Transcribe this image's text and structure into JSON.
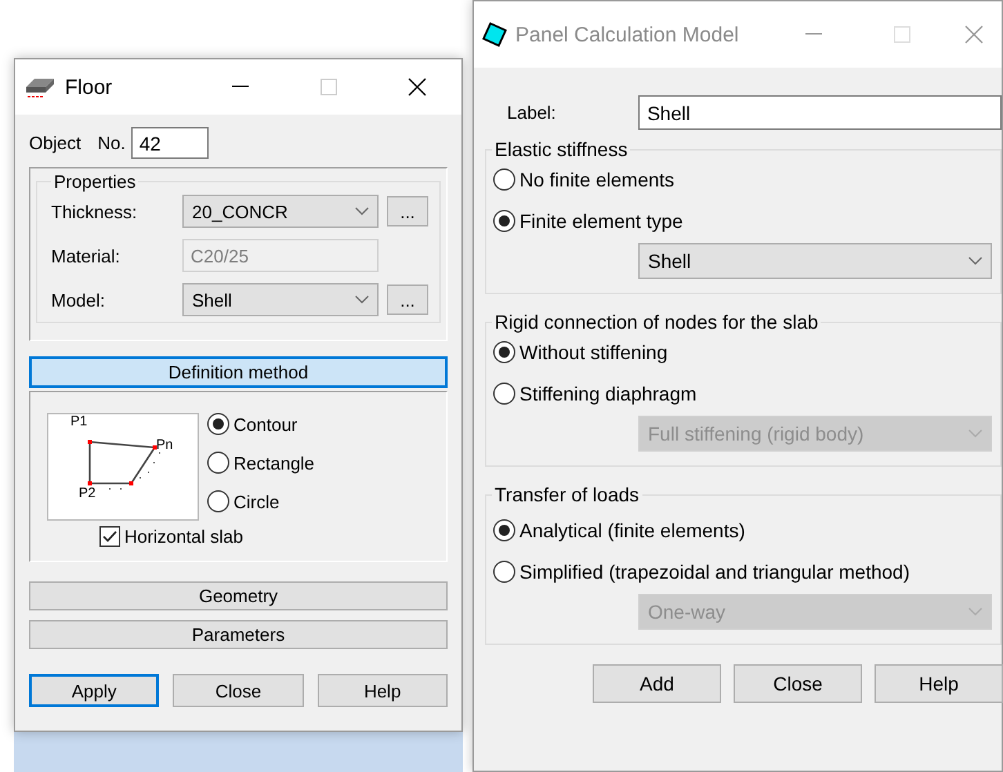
{
  "floor_window": {
    "title": "Floor",
    "active": true,
    "object_label": "Object",
    "number_label": "No.",
    "number_value": "42",
    "properties": {
      "title": "Properties",
      "rows": [
        {
          "kind": "dropdown",
          "label": "Thickness:",
          "value": "20_CONCR",
          "more": "..."
        },
        {
          "kind": "readonly",
          "label": "Material:",
          "value": "C20/25",
          "disabled": true
        },
        {
          "kind": "dropdown",
          "label": "Model:",
          "value": "Shell",
          "more": "..."
        }
      ]
    },
    "definition_method": {
      "title": "Definition method",
      "diagram_labels": [
        "P1",
        "Pn",
        "P2"
      ],
      "options": [
        {
          "label": "Contour",
          "selected": true
        },
        {
          "label": "Rectangle",
          "selected": false
        },
        {
          "label": "Circle",
          "selected": false
        }
      ],
      "horizontal_slab": {
        "label": "Horizontal slab",
        "checked": true
      }
    },
    "sections": [
      "Geometry",
      "Parameters"
    ],
    "buttons": [
      {
        "label": "Apply",
        "focused": true
      },
      {
        "label": "Close",
        "focused": false
      },
      {
        "label": "Help",
        "focused": false
      }
    ]
  },
  "panel_window": {
    "title": "Panel Calculation Model",
    "active": false,
    "label_field": {
      "label": "Label:",
      "value": "Shell"
    },
    "groups": [
      {
        "title": "Elastic stiffness",
        "options": [
          {
            "label": "No finite elements",
            "selected": false
          },
          {
            "label": "Finite element type",
            "selected": true
          }
        ],
        "dropdown": {
          "value": "Shell",
          "disabled": false
        }
      },
      {
        "title": "Rigid connection of nodes for the slab",
        "options": [
          {
            "label": "Without stiffening",
            "selected": true
          },
          {
            "label": "Stiffening diaphragm",
            "selected": false
          }
        ],
        "dropdown": {
          "value": "Full stiffening (rigid body)",
          "disabled": true
        }
      },
      {
        "title": "Transfer of loads",
        "options": [
          {
            "label": "Analytical (finite elements)",
            "selected": true
          },
          {
            "label": "Simplified (trapezoidal and triangular method)",
            "selected": false
          }
        ],
        "dropdown": {
          "value": "One-way",
          "disabled": true
        }
      }
    ],
    "buttons": [
      {
        "label": "Add",
        "focused": false
      },
      {
        "label": "Close",
        "focused": false
      },
      {
        "label": "Help",
        "focused": false
      }
    ]
  }
}
